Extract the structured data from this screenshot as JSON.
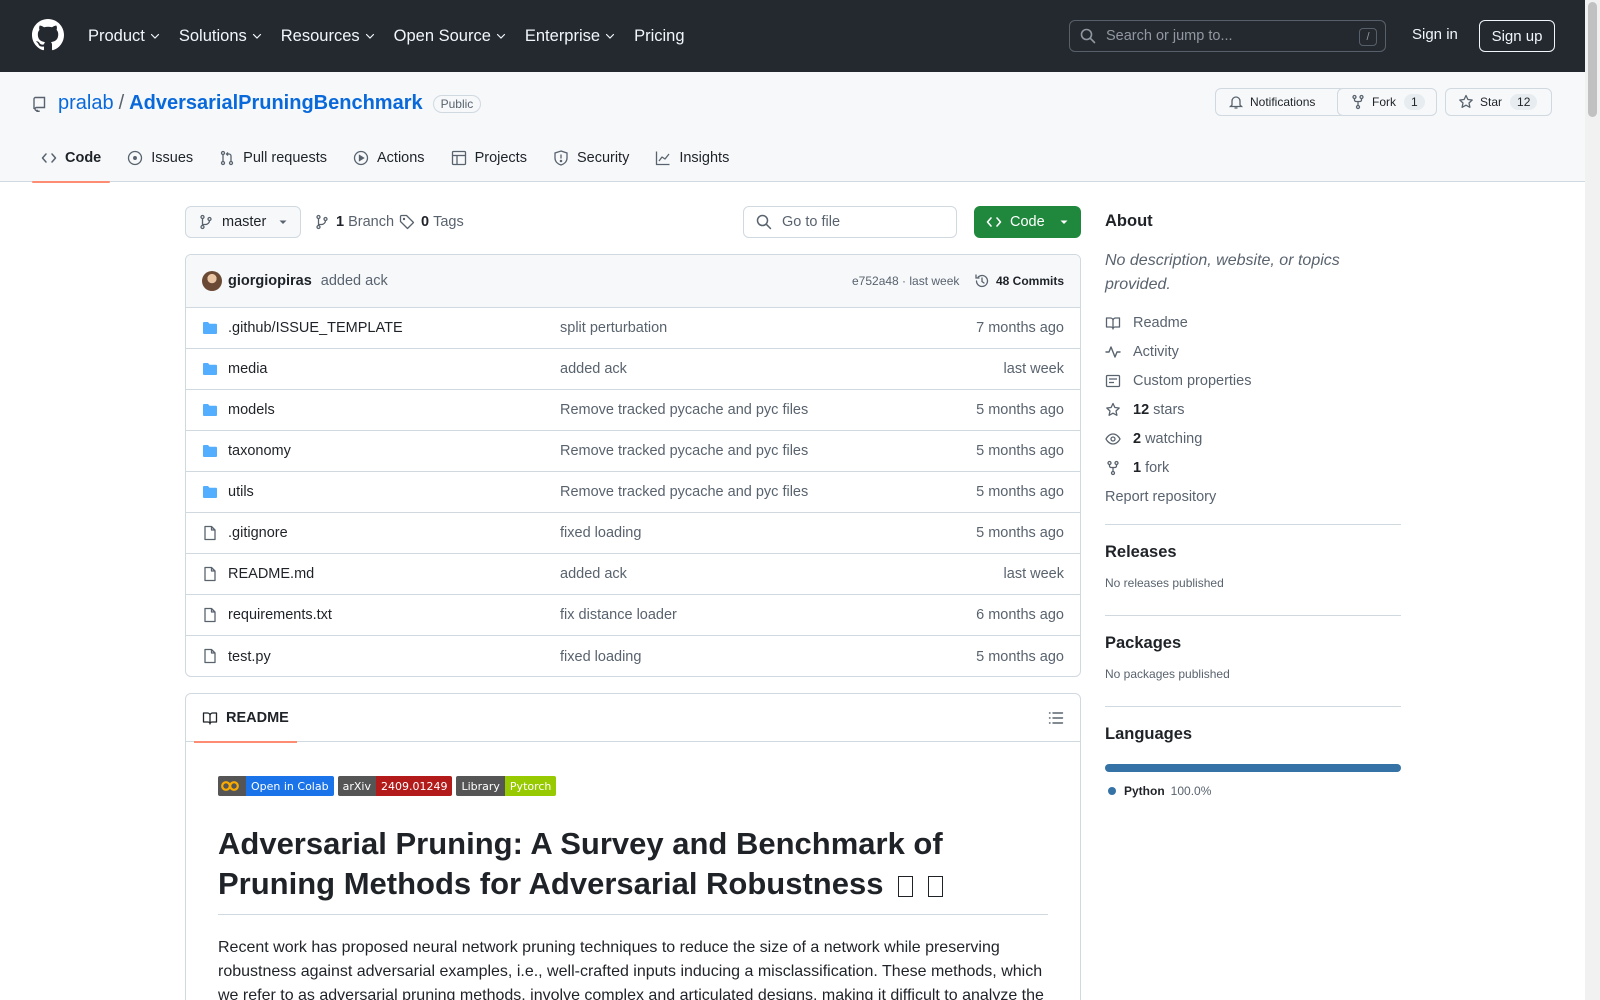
{
  "header": {
    "nav": [
      "Product",
      "Solutions",
      "Resources",
      "Open Source",
      "Enterprise",
      "Pricing"
    ],
    "search_placeholder": "Search or jump to...",
    "search_key": "/",
    "sign_in": "Sign in",
    "sign_up": "Sign up"
  },
  "repo": {
    "owner": "pralab",
    "separator": "/",
    "name": "AdversarialPruningBenchmark",
    "visibility": "Public",
    "notifications_label": "Notifications",
    "fork_label": "Fork",
    "fork_count": "1",
    "star_label": "Star",
    "star_count": "12"
  },
  "tabs": [
    "Code",
    "Issues",
    "Pull requests",
    "Actions",
    "Projects",
    "Security",
    "Insights"
  ],
  "toolbar": {
    "branch": "master",
    "branch_count": "1",
    "branch_label": "Branch",
    "tag_count": "0",
    "tag_label": "Tags",
    "goto_file": "Go to file",
    "code_button": "Code"
  },
  "commit": {
    "author": "giorgiopiras",
    "message": "added ack",
    "hash": "e752a48 · last week",
    "commits": "48 Commits"
  },
  "files": [
    {
      "type": "folder",
      "name": ".github/ISSUE_TEMPLATE",
      "message": "split perturbation",
      "date": "7 months ago"
    },
    {
      "type": "folder",
      "name": "media",
      "message": "added ack",
      "date": "last week"
    },
    {
      "type": "folder",
      "name": "models",
      "message": "Remove tracked pycache and pyc files",
      "date": "5 months ago"
    },
    {
      "type": "folder",
      "name": "taxonomy",
      "message": "Remove tracked pycache and pyc files",
      "date": "5 months ago"
    },
    {
      "type": "folder",
      "name": "utils",
      "message": "Remove tracked pycache and pyc files",
      "date": "5 months ago"
    },
    {
      "type": "file",
      "name": ".gitignore",
      "message": "fixed loading",
      "date": "5 months ago"
    },
    {
      "type": "file",
      "name": "README.md",
      "message": "added ack",
      "date": "last week"
    },
    {
      "type": "file",
      "name": "requirements.txt",
      "message": "fix distance loader",
      "date": "6 months ago"
    },
    {
      "type": "file",
      "name": "test.py",
      "message": "fixed loading",
      "date": "5 months ago"
    }
  ],
  "readme": {
    "tab_label": "README",
    "badges": [
      {
        "left": "Open in Colab",
        "right": "",
        "left_color": "#1a73e8",
        "right_color": ""
      },
      {
        "left": "arXiv",
        "right": "2409.01249",
        "left_color": "#555555",
        "right_color": "#b31b1b"
      },
      {
        "left": "Library",
        "right": "Pytorch",
        "left_color": "#555555",
        "right_color": "#97ca00"
      }
    ],
    "title": "Adversarial Pruning: A Survey and Benchmark of Pruning Methods for Adversarial Robustness",
    "paragraph": "Recent work has proposed neural network pruning techniques to reduce the size of a network while preserving robustness against adversarial examples, i.e., well-crafted inputs inducing a misclassification. These methods, which we refer to as adversarial pruning methods, involve complex and articulated designs, making it difficult to analyze the"
  },
  "about": {
    "title": "About",
    "description": "No description, website, or topics provided.",
    "readme": "Readme",
    "activity": "Activity",
    "custom_properties": "Custom properties",
    "stars_count": "12",
    "stars_label": "stars",
    "watching_count": "2",
    "watching_label": "watching",
    "fork_count": "1",
    "fork_label": "fork",
    "report": "Report repository"
  },
  "releases": {
    "title": "Releases",
    "empty": "No releases published"
  },
  "packages": {
    "title": "Packages",
    "empty": "No packages published"
  },
  "languages": {
    "title": "Languages",
    "name": "Python",
    "percent": "100.0%",
    "color": "#3572a5"
  }
}
